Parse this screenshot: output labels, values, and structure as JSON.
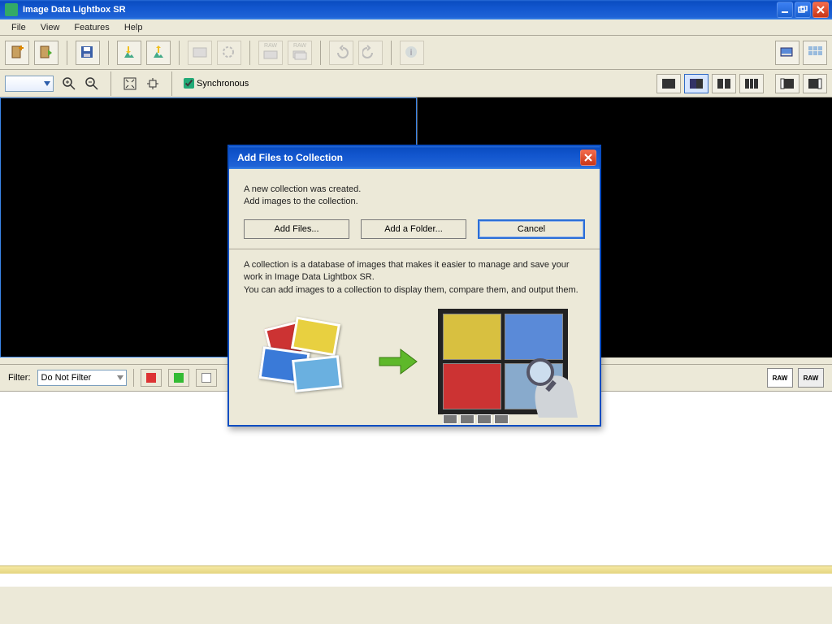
{
  "app": {
    "title": "Image Data Lightbox SR"
  },
  "menus": {
    "file": "File",
    "view": "View",
    "features": "Features",
    "help": "Help"
  },
  "toolbar2": {
    "sync_label": "Synchronous",
    "sync_checked": true
  },
  "filter": {
    "label": "Filter:",
    "value": "Do Not Filter",
    "raw": "RAW"
  },
  "dialog": {
    "title": "Add Files to Collection",
    "msg1": "A new collection was created.",
    "msg2": "Add images to the collection.",
    "btn_add_files": "Add Files...",
    "btn_add_folder": "Add a Folder...",
    "btn_cancel": "Cancel",
    "info1": "A collection is a database of images that makes it easier to manage and save your work in Image Data Lightbox SR.",
    "info2": "You can add images to a collection to display them, compare them, and output them."
  }
}
